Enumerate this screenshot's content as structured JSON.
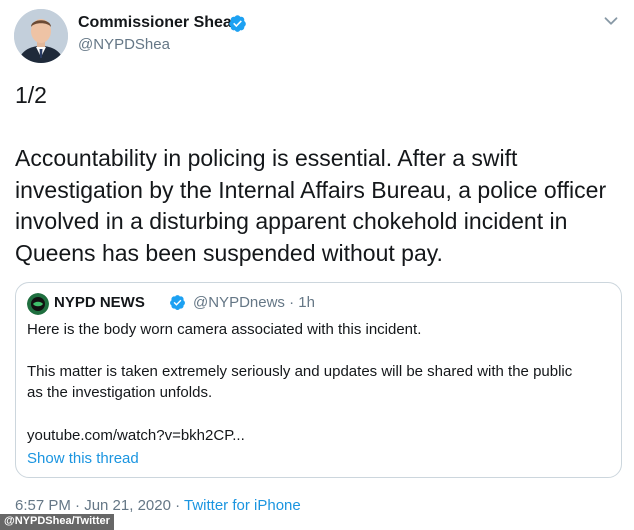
{
  "author": {
    "name": "Commissioner Shea",
    "handle": "@NYPDShea",
    "verified": true
  },
  "tweet": {
    "thread_marker": "1/2",
    "text": "Accountability in policing is essential. After a swift investigation by the Internal Affairs Bureau, a police officer involved in a disturbing apparent chokehold incident in Queens has been suspended without pay."
  },
  "quoted_tweet": {
    "name": "NYPD NEWS",
    "handle": "@NYPDnews · 1h",
    "verified": true,
    "line1": "Here is the body worn camera associated with this incident.",
    "line2": "This matter is taken extremely seriously and updates will be shared with the public",
    "line3": "as the investigation unfolds.",
    "line4": "youtube.com/watch?v=bkh2CP...",
    "show_thread": "Show this thread"
  },
  "meta": {
    "timestamp": "6:57 PM · Jun 21, 2020 · ",
    "source": "Twitter for iPhone"
  },
  "credit": "@NYPDShea/Twitter",
  "icons": {
    "verified": "verified-badge-icon",
    "menu": "chevron-down-icon"
  },
  "colors": {
    "link": "#1b95e0",
    "verified": "#1da1f2",
    "secondary_text": "#657786",
    "border": "#ccd6dd"
  }
}
